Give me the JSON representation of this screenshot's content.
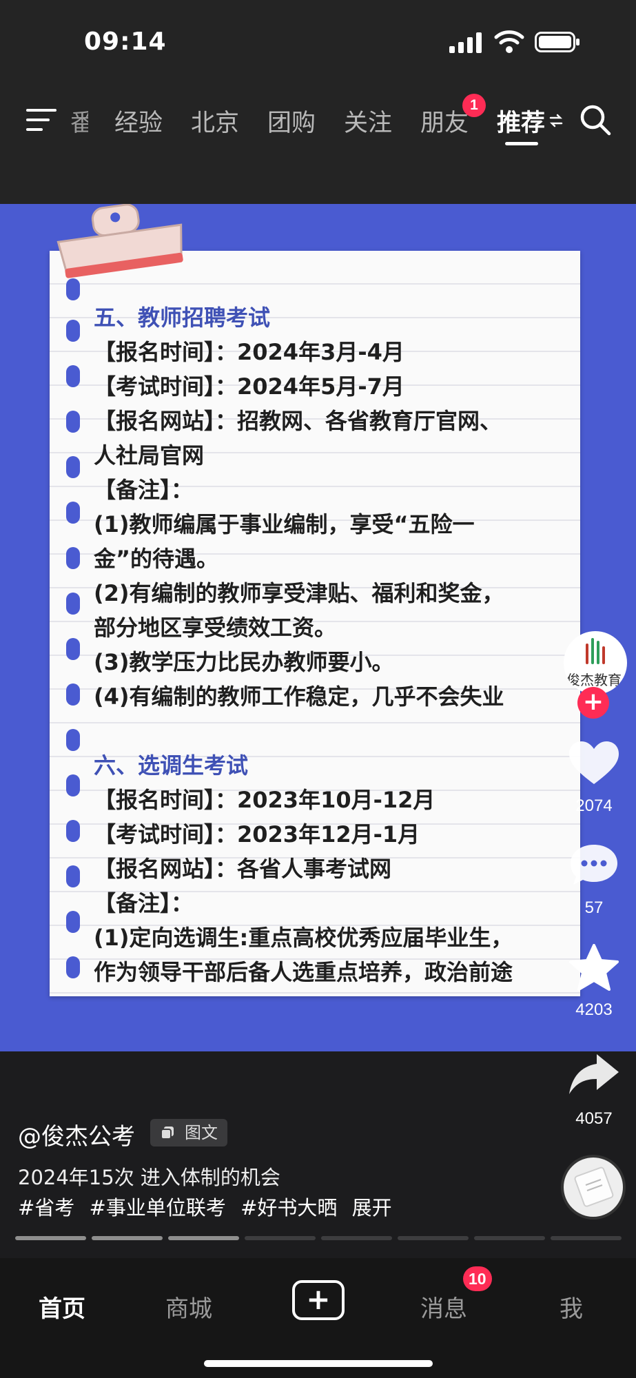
{
  "status_bar": {
    "time": "09:14"
  },
  "top_nav": {
    "tabs": [
      {
        "label": "番",
        "active": false
      },
      {
        "label": "经验",
        "active": false
      },
      {
        "label": "北京",
        "active": false
      },
      {
        "label": "团购",
        "active": false
      },
      {
        "label": "关注",
        "active": false
      },
      {
        "label": "朋友",
        "active": false,
        "badge": "1"
      },
      {
        "label": "推荐",
        "active": true
      }
    ]
  },
  "note": {
    "section5": {
      "title": "五、教师招聘考试",
      "register_time": "【报名时间】：2024年3月-4月",
      "exam_time": "【考试时间】：2024年5月-7月",
      "website_1": "【报名网站】：招教网、各省教育厅官网、",
      "website_2": "人社局官网",
      "remark": "【备注】：",
      "lines": [
        "(1)教师编属于事业编制，享受“五险一",
        "金”的待遇。",
        "(2)有编制的教师享受津贴、福利和奖金，",
        "部分地区享受绩效工资。",
        "(3)教学压力比民办教师要小。",
        "(4)有编制的教师工作稳定，几乎不会失业"
      ]
    },
    "section6": {
      "title": "六、选调生考试",
      "register_time": "【报名时间】：2023年10月-12月",
      "exam_time": "【考试时间】：2023年12月-1月",
      "website": "【报名网站】：各省人事考试网",
      "remark": "【备注】：",
      "lines": [
        "(1)定向选调生:重点高校优秀应届毕业生，",
        "作为领导干部后备人选重点培养，政治前途"
      ]
    }
  },
  "actions": {
    "avatar_text": "俊杰教育",
    "likes": "2074",
    "comments": "57",
    "favorites": "4203",
    "shares": "4057"
  },
  "post": {
    "author": "@俊杰公考",
    "type_label": "图文",
    "caption": "2024年15次 进入体制的机会",
    "tags": [
      "#省考",
      "#事业单位联考",
      "#好书大晒"
    ],
    "expand": "展开",
    "progress": {
      "total": 8,
      "current": 3
    }
  },
  "tab_bar": {
    "home": "首页",
    "mall": "商城",
    "messages": "消息",
    "messages_badge": "10",
    "me": "我"
  },
  "colors": {
    "accent": "#fe2c55",
    "content_bg": "#4a5bd1",
    "section_title": "#3f51b5"
  }
}
